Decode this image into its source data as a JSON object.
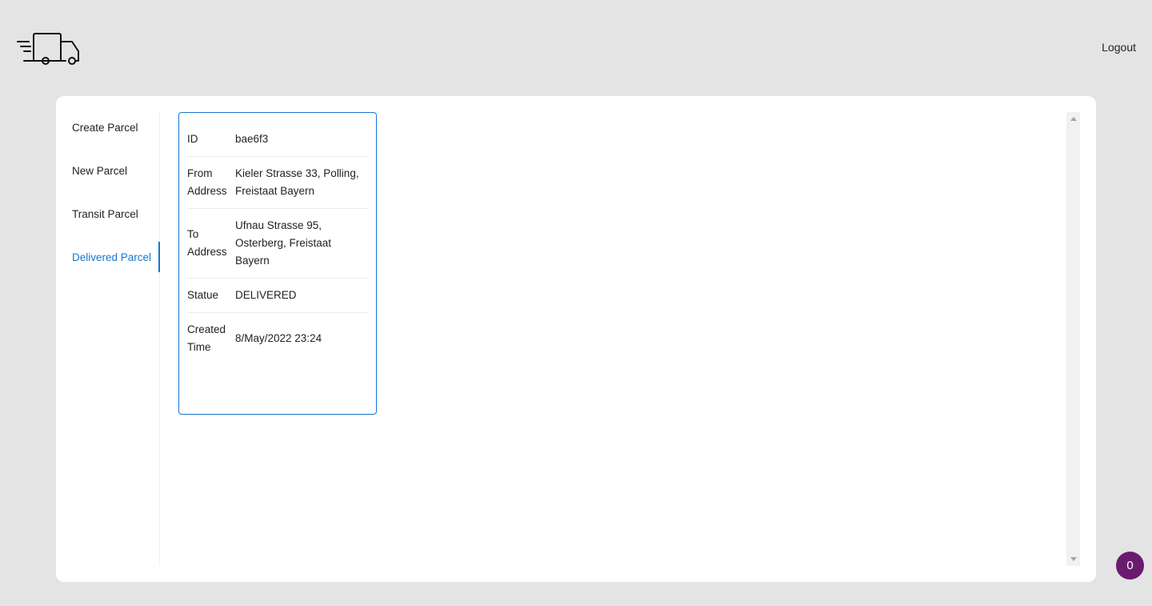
{
  "header": {
    "logo_icon": "delivery-truck-icon",
    "logout_label": "Logout"
  },
  "sidebar": {
    "items": [
      {
        "label": "Create Parcel",
        "active": false
      },
      {
        "label": "New Parcel",
        "active": false
      },
      {
        "label": "Transit Parcel",
        "active": false
      },
      {
        "label": "Delivered Parcel",
        "active": true
      }
    ]
  },
  "parcel": {
    "rows": [
      {
        "label": "ID",
        "value": "bae6f3"
      },
      {
        "label": "From Address",
        "value": "Kieler Strasse 33, Polling, Freistaat Bayern"
      },
      {
        "label": "To Address",
        "value": "Ufnau Strasse 95, Osterberg, Freistaat Bayern"
      },
      {
        "label": "Statue",
        "value": "DELIVERED"
      },
      {
        "label": "Created Time",
        "value": "8/May/2022 23:24"
      }
    ]
  },
  "badge": {
    "count": "0",
    "color": "#6a1b6e"
  },
  "colors": {
    "accent": "#1677d2",
    "background": "#e4e4e4"
  }
}
